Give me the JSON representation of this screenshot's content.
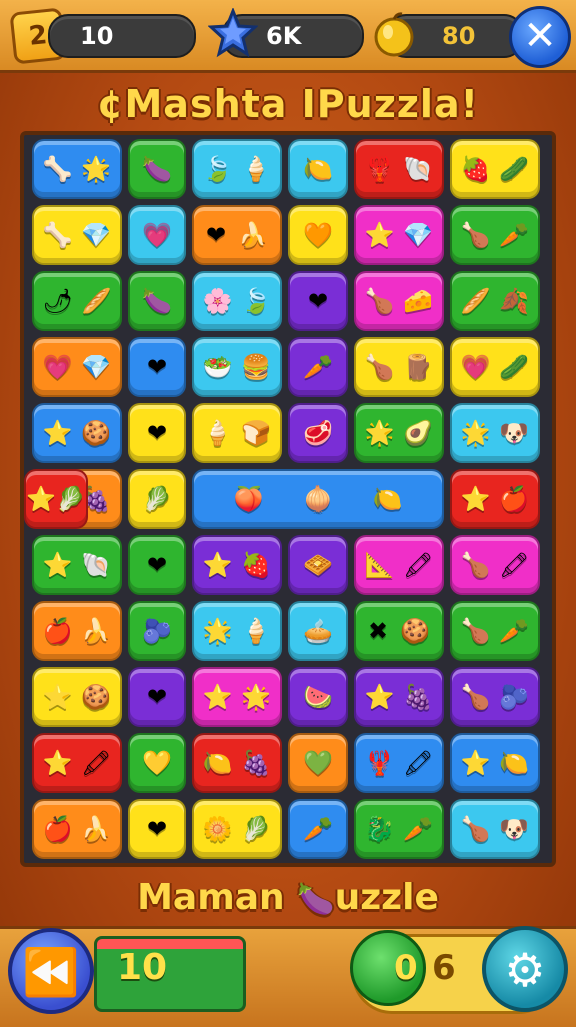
{
  "hud": {
    "level": "2",
    "moves_counter": "10",
    "stars": "6K",
    "coins": "80",
    "close_symbol": "✕"
  },
  "title": "¢Mashta ⅠPuzzla!",
  "colors": {
    "blue": "#2f8cf0",
    "green": "#2fb52f",
    "cyan": "#3cc8ef",
    "yellow": "#ffe11a",
    "red": "#e8251f",
    "magenta": "#f02fc8",
    "orange": "#ff8c1a",
    "purple": "#7a2ed6"
  },
  "board": {
    "rows": [
      [
        {
          "c": "blue",
          "s": 2,
          "g": [
            "🦴",
            "🌟"
          ]
        },
        {
          "c": "green",
          "s": 1,
          "g": [
            "🍆"
          ]
        },
        {
          "c": "cyan",
          "s": 2,
          "g": [
            "🍃",
            "🍦"
          ]
        },
        {
          "c": "cyan",
          "s": 1,
          "g": [
            "🍋"
          ]
        },
        {
          "c": "red",
          "s": 2,
          "g": [
            "🦞",
            "🐚"
          ]
        },
        {
          "c": "yellow",
          "s": 2,
          "g": [
            "🍓",
            "🥒"
          ]
        }
      ],
      [
        {
          "c": "yellow",
          "s": 2,
          "g": [
            "🦴",
            "💎"
          ]
        },
        {
          "c": "cyan",
          "s": 1,
          "g": [
            "💗"
          ]
        },
        {
          "c": "orange",
          "s": 2,
          "g": [
            "❤",
            "🍌"
          ]
        },
        {
          "c": "yellow",
          "s": 1,
          "g": [
            "🧡"
          ]
        },
        {
          "c": "magenta",
          "s": 2,
          "g": [
            "⭐",
            "💎"
          ]
        },
        {
          "c": "green",
          "s": 2,
          "g": [
            "🍗",
            "🥕"
          ]
        }
      ],
      [
        {
          "c": "green",
          "s": 2,
          "g": [
            "🌶",
            "🥖"
          ]
        },
        {
          "c": "green",
          "s": 1,
          "g": [
            "🍆"
          ]
        },
        {
          "c": "cyan",
          "s": 2,
          "g": [
            "🌸",
            "🍃"
          ]
        },
        {
          "c": "purple",
          "s": 1,
          "g": [
            "❤"
          ]
        },
        {
          "c": "magenta",
          "s": 2,
          "g": [
            "🍗",
            "🧀"
          ]
        },
        {
          "c": "green",
          "s": 2,
          "g": [
            "🥖",
            "🍂"
          ]
        }
      ],
      [
        {
          "c": "orange",
          "s": 2,
          "g": [
            "💗",
            "💎"
          ]
        },
        {
          "c": "blue",
          "s": 1,
          "g": [
            "❤"
          ]
        },
        {
          "c": "cyan",
          "s": 2,
          "g": [
            "🥗",
            "🍔"
          ]
        },
        {
          "c": "purple",
          "s": 1,
          "g": [
            "🥕"
          ]
        },
        {
          "c": "yellow",
          "s": 2,
          "g": [
            "🍗",
            "🪵"
          ]
        },
        {
          "c": "yellow",
          "s": 2,
          "g": [
            "💗",
            "🥒"
          ]
        }
      ],
      [
        {
          "c": "blue",
          "s": 2,
          "g": [
            "⭐",
            "🍪"
          ]
        },
        {
          "c": "yellow",
          "s": 1,
          "g": [
            "❤"
          ]
        },
        {
          "c": "yellow",
          "s": 2,
          "g": [
            "🍦",
            "🍞"
          ]
        },
        {
          "c": "purple",
          "s": 1,
          "g": [
            "🥩"
          ]
        },
        {
          "c": "green",
          "s": 2,
          "g": [
            "🌟",
            "🥑"
          ]
        },
        {
          "c": "cyan",
          "s": 2,
          "g": [
            "🌟",
            "🐶"
          ]
        }
      ],
      [
        {
          "c": "orange",
          "s": 2,
          "g": [
            "⭐",
            "🍇"
          ]
        },
        {
          "c": "yellow",
          "s": 1,
          "g": [
            "🥬"
          ]
        },
        {
          "c": "blue",
          "s": 3,
          "g": [
            "🍑",
            "🧅",
            "🍋"
          ]
        },
        {
          "c": "red",
          "s": 2,
          "g": [
            "⭐",
            "🍎"
          ]
        },
        {
          "c": "red",
          "s": 2,
          "g": [
            "⭐",
            "🥬"
          ]
        }
      ],
      [
        {
          "c": "green",
          "s": 2,
          "g": [
            "⭐",
            "🐚"
          ]
        },
        {
          "c": "green",
          "s": 1,
          "g": [
            "❤"
          ]
        },
        {
          "c": "purple",
          "s": 2,
          "g": [
            "⭐",
            "🍓"
          ]
        },
        {
          "c": "purple",
          "s": 1,
          "g": [
            "🧇"
          ]
        },
        {
          "c": "magenta",
          "s": 2,
          "g": [
            "📐",
            "🖍"
          ]
        },
        {
          "c": "magenta",
          "s": 2,
          "g": [
            "🍗",
            "🖍"
          ]
        }
      ],
      [
        {
          "c": "orange",
          "s": 2,
          "g": [
            "🍎",
            "🍌"
          ]
        },
        {
          "c": "green",
          "s": 1,
          "g": [
            "🫐"
          ]
        },
        {
          "c": "cyan",
          "s": 2,
          "g": [
            "🌟",
            "🍦"
          ]
        },
        {
          "c": "cyan",
          "s": 1,
          "g": [
            "🥧"
          ]
        },
        {
          "c": "green",
          "s": 2,
          "g": [
            "✖",
            "🍪"
          ]
        },
        {
          "c": "green",
          "s": 2,
          "g": [
            "🍗",
            "🥕"
          ]
        }
      ],
      [
        {
          "c": "yellow",
          "s": 2,
          "g": [
            "⭐",
            "🍪"
          ]
        },
        {
          "c": "purple",
          "s": 1,
          "g": [
            "❤"
          ]
        },
        {
          "c": "magenta",
          "s": 2,
          "g": [
            "⭐",
            "🌟"
          ]
        },
        {
          "c": "purple",
          "s": 1,
          "g": [
            "🍉"
          ]
        },
        {
          "c": "purple",
          "s": 2,
          "g": [
            "⭐",
            "🍇"
          ]
        },
        {
          "c": "purple",
          "s": 2,
          "g": [
            "🍗",
            "🫐"
          ]
        }
      ],
      [
        {
          "c": "red",
          "s": 2,
          "g": [
            "⭐",
            "🖍"
          ]
        },
        {
          "c": "green",
          "s": 1,
          "g": [
            "💛"
          ]
        },
        {
          "c": "red",
          "s": 2,
          "g": [
            "🍋",
            "🍇"
          ]
        },
        {
          "c": "orange",
          "s": 1,
          "g": [
            "💚"
          ]
        },
        {
          "c": "blue",
          "s": 2,
          "g": [
            "🦞",
            "🖍"
          ]
        },
        {
          "c": "blue",
          "s": 2,
          "g": [
            "⭐",
            "🍋"
          ]
        }
      ],
      [
        {
          "c": "orange",
          "s": 2,
          "g": [
            "🍎",
            "🍌"
          ]
        },
        {
          "c": "yellow",
          "s": 1,
          "g": [
            "❤"
          ]
        },
        {
          "c": "yellow",
          "s": 2,
          "g": [
            "🌼",
            "🥬"
          ]
        },
        {
          "c": "blue",
          "s": 1,
          "g": [
            "🥕"
          ]
        },
        {
          "c": "green",
          "s": 2,
          "g": [
            "🐉",
            "🥕"
          ]
        },
        {
          "c": "cyan",
          "s": 2,
          "g": [
            "🍗",
            "🐶"
          ]
        }
      ]
    ]
  },
  "bottom": {
    "title_left": "Maman",
    "title_right": "uzzle",
    "plum_icon": "🍆",
    "moves": "10",
    "score_a": "0",
    "score_b": "6",
    "back_symbol": "⏪",
    "gear_symbol": "⚙"
  }
}
